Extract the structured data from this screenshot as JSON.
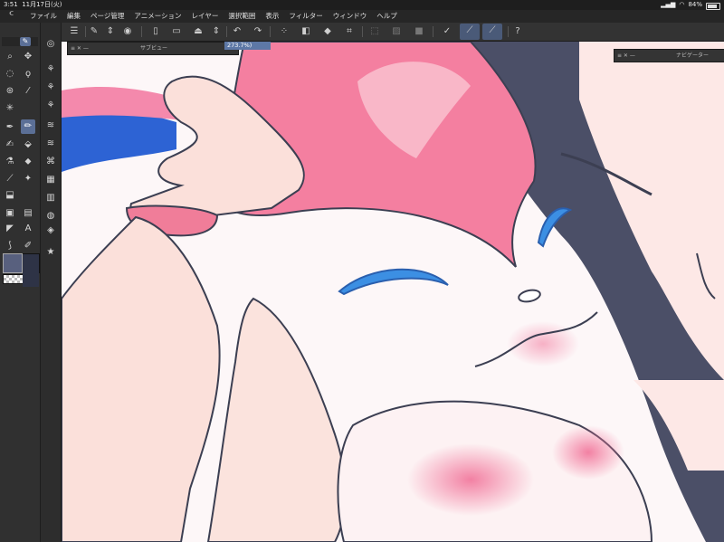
{
  "status_bar": {
    "time": "3:51",
    "date": "11月17日(火)",
    "battery": "84%"
  },
  "menu_bar": {
    "items": [
      {
        "label": "ファイル"
      },
      {
        "label": "編集"
      },
      {
        "label": "ページ管理"
      },
      {
        "label": "アニメーション"
      },
      {
        "label": "レイヤー"
      },
      {
        "label": "選択範囲"
      },
      {
        "label": "表示"
      },
      {
        "label": "フィルター"
      },
      {
        "label": "ウィンドウ"
      },
      {
        "label": "ヘルプ"
      }
    ]
  },
  "palettes": {
    "sub_view": {
      "title": "サブビュー"
    },
    "navigator": {
      "title": "ナビゲーター"
    }
  },
  "canvas_tab": {
    "zoom": "273.7%)"
  },
  "colors": {
    "accent": "#5b6f96",
    "main_color": "#58607e",
    "sub_color": "#2e3346",
    "bg": "#2b2b2b"
  },
  "icons": {
    "menu": "hamburger-icon",
    "canvas_fit": "fit-icon",
    "undo": "undo-icon",
    "redo": "redo-icon",
    "help": "help-icon"
  }
}
